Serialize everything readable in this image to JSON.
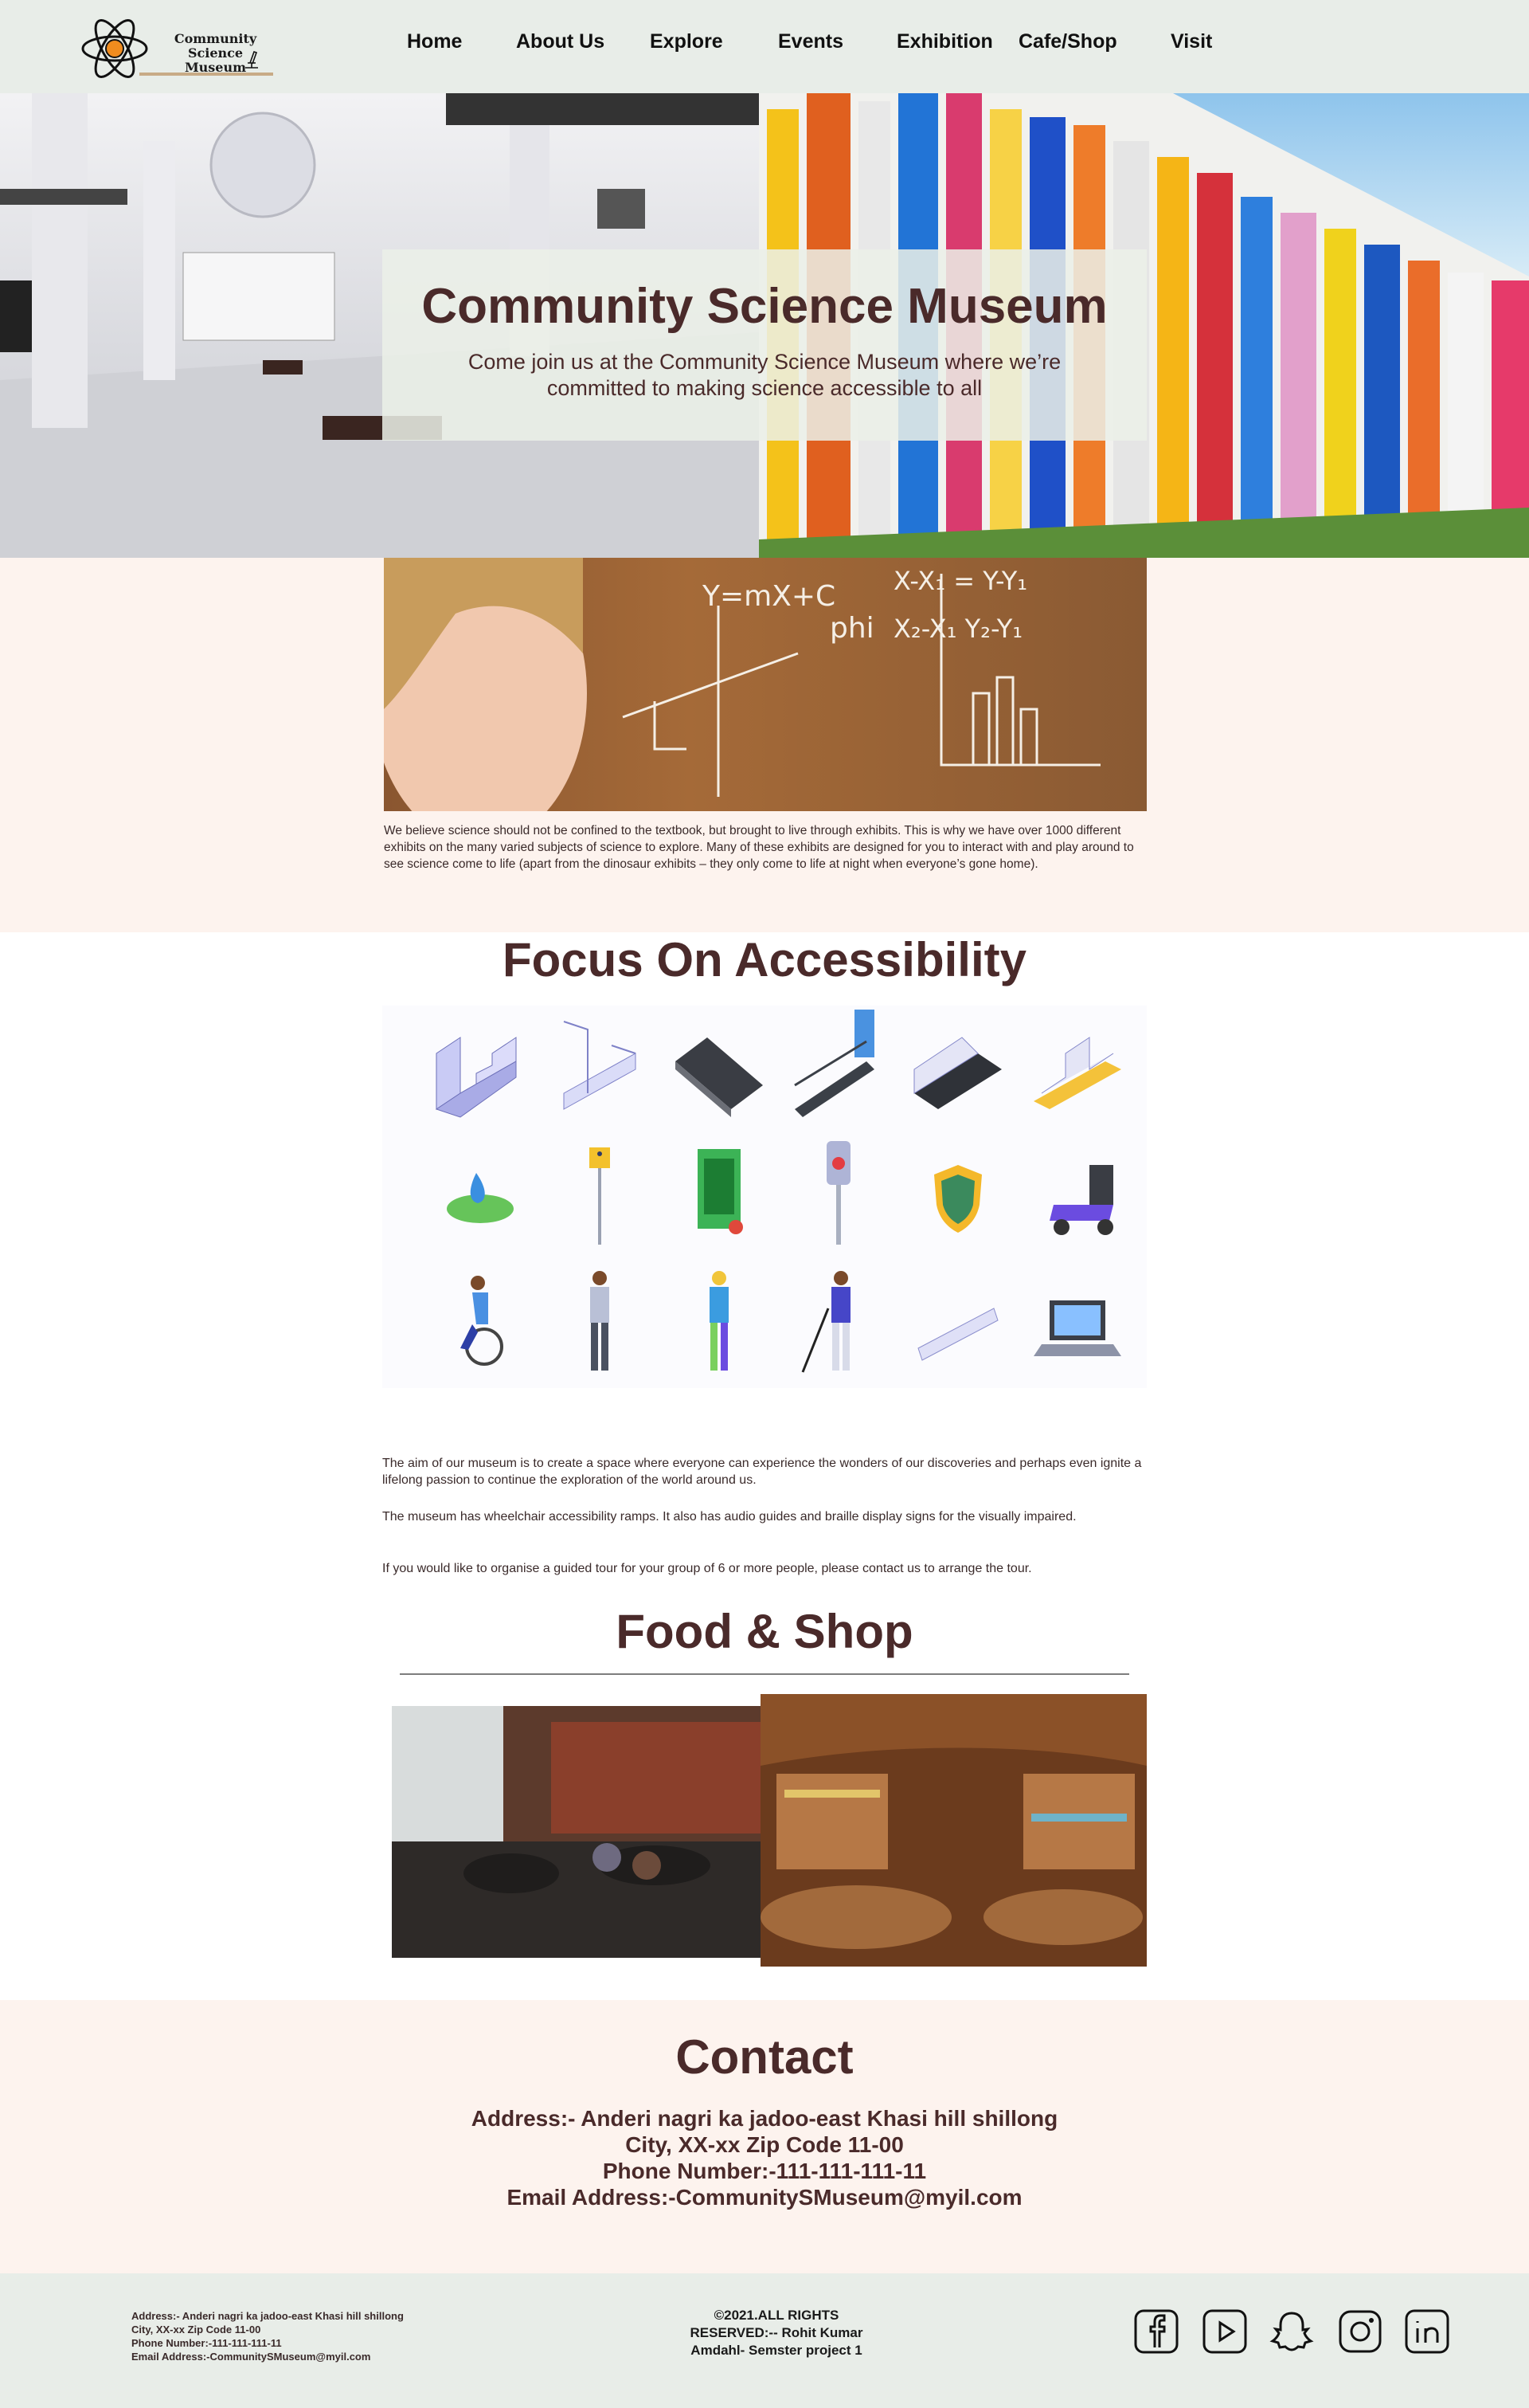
{
  "brand": {
    "line1": "Community Science",
    "line2": "Museum"
  },
  "nav": [
    {
      "label": "Home"
    },
    {
      "label": "About  Us"
    },
    {
      "label": "Explore"
    },
    {
      "label": "Events"
    },
    {
      "label": "Exhibition"
    },
    {
      "label": "Cafe/Shop"
    },
    {
      "label": "Visit"
    }
  ],
  "hero": {
    "title": "Community Science Museum",
    "subtitle": "Come join us at the Community Science Museum where we’re committed to making science accessible to all"
  },
  "intro": {
    "text": "We believe science should not be confined to the textbook, but brought to live through exhibits. This is why we have over 1000 different exhibits on the many varied subjects of science to explore. Many of these exhibits are designed for you to interact with and play around to see science come to life (apart from the dinosaur exhibits – they only come to life at night when everyone’s gone home)."
  },
  "accessibility": {
    "title": "Focus On Accessibility",
    "icons": [
      "stairs-with-lift-icon",
      "ramp-stairs-icon",
      "escalator-icon",
      "ramp-with-door-icon",
      "stair-lift-icon",
      "tactile-stairs-icon",
      "water-drop-leaf-icon",
      "accessibility-sign-icon",
      "certificate-icon",
      "crosswalk-button-icon",
      "shield-badge-icon",
      "mobility-scooter-icon",
      "wheelchair-user-icon",
      "person-with-crutch-icon",
      "person-with-prosthetic-icon",
      "person-with-cane-icon",
      "ramp-icon",
      "braille-laptop-icon"
    ],
    "paragraphs": [
      "The aim of our museum is to create a space where everyone can experience the wonders of our discoveries and perhaps even ignite a lifelong passion to continue the exploration of the world around us.",
      "The museum has wheelchair accessibility ramps. It also has audio guides and braille display signs for the visually impaired.",
      "If you would like to organise a guided tour for your group of 6 or more people, please contact us to arrange the tour."
    ]
  },
  "food": {
    "title": "Food & Shop"
  },
  "contact": {
    "title": "Contact",
    "address": "Address:- Anderi nagri ka jadoo-east Khasi hill shillong",
    "city": "City, XX-xx Zip Code 11-00",
    "phone": "Phone Number:-111-111-111-11",
    "email": "Email Address:-CommunitySMuseum@myil.com"
  },
  "footer": {
    "address": "Address:- Anderi nagri ka jadoo-east Khasi hill shillong",
    "city": "City, XX-xx Zip Code 11-00",
    "phone": "Phone Number:-111-111-111-11",
    "email": "Email Address:-CommunitySMuseum@myil.com",
    "copyright": "©2021.ALL RIGHTS RESERVED:-- Rohit Kumar Amdahl- Semster project 1",
    "social": [
      "facebook-icon",
      "youtube-icon",
      "snapchat-icon",
      "instagram-icon",
      "linkedin-icon"
    ]
  },
  "colors": {
    "accent": "#4a2a2a",
    "header_bg": "#e8ede8",
    "section_bg": "#fdf3ee"
  }
}
